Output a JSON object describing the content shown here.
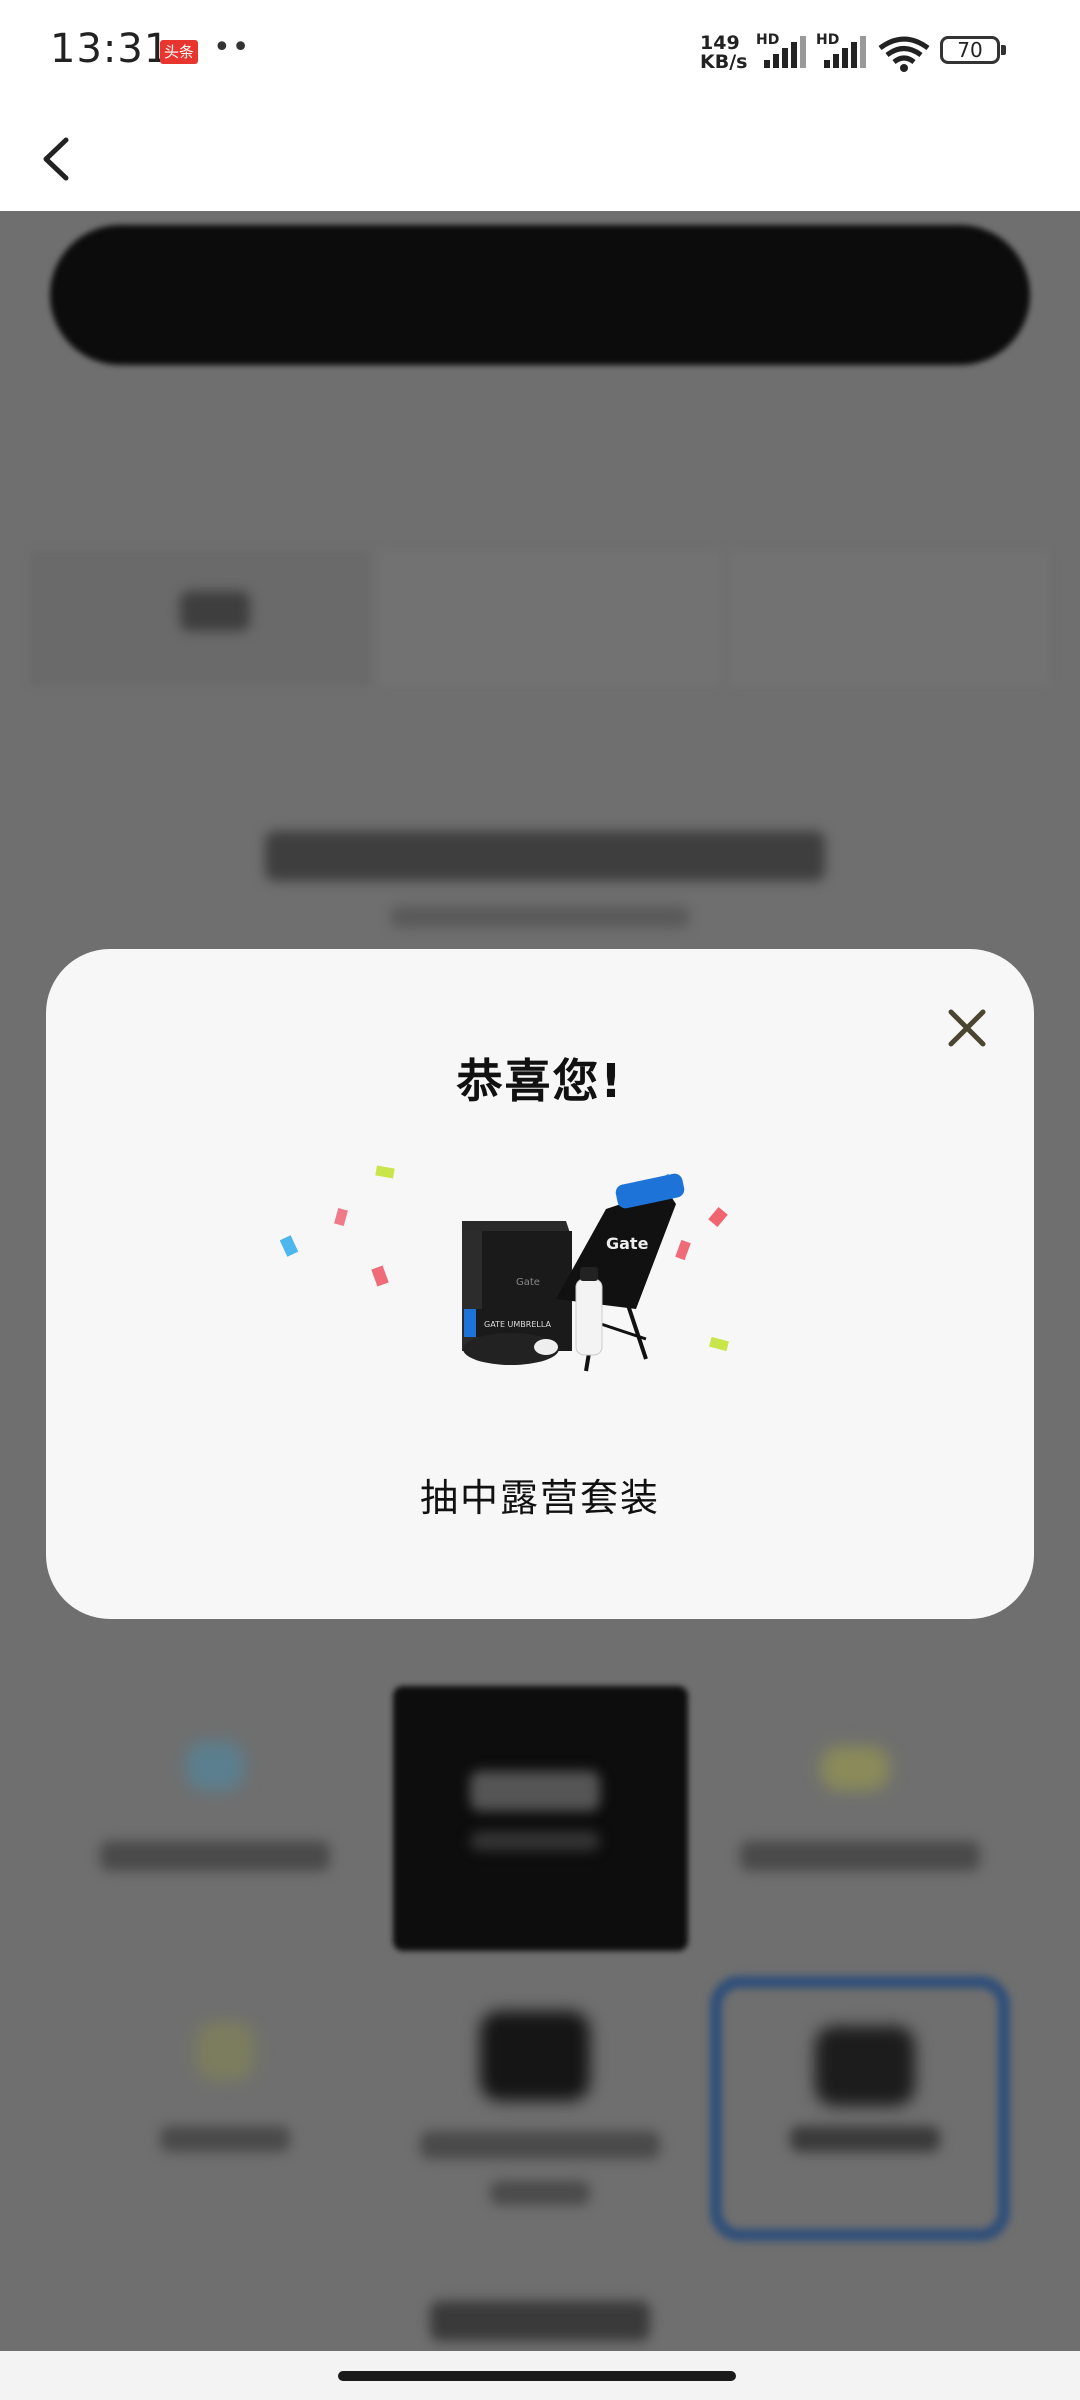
{
  "status_bar": {
    "time": "13:31",
    "notification_badge": "头条",
    "more": "••",
    "net_speed_value": "149",
    "net_speed_unit": "KB/s",
    "signal_1_label": "HD",
    "signal_2_label": "HD",
    "battery": "70"
  },
  "nav": {
    "back_icon": "chevron-left-icon"
  },
  "modal": {
    "title": "恭喜您!",
    "prize_label": "抽中露营套装",
    "close_icon": "close-icon",
    "prize_brand": "Gate",
    "umbrella_text": "GATE UMBRELLA"
  },
  "colors": {
    "overlay": "#6f6f6f",
    "modal_bg": "#f7f7f7",
    "close_icon": "#4a4632",
    "accent_blue": "#1e73d8",
    "badge_red": "#e8352e"
  }
}
